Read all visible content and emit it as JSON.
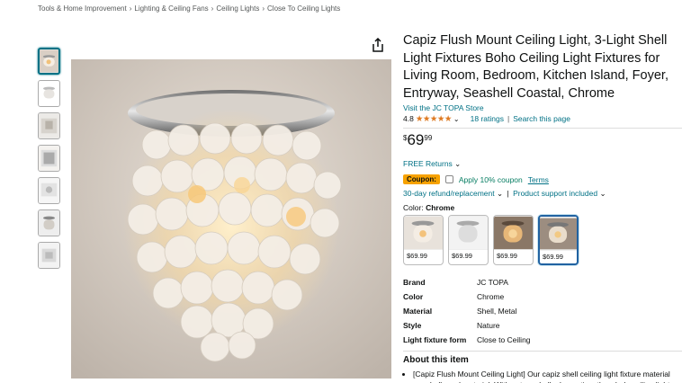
{
  "breadcrumb": [
    "Tools & Home Improvement",
    "Lighting & Ceiling Fans",
    "Ceiling Lights",
    "Close To Ceiling Lights"
  ],
  "breadcrumb_sep": "›",
  "product": {
    "title": "Capiz Flush Mount Ceiling Light, 3-Light Shell Light Fixtures Boho Ceiling Light Fixtures for Living Room, Bedroom, Kitchen Island, Foyer, Entryway, Seashell Coastal, Chrome",
    "store": "Visit the JC TOPA Store",
    "rating": "4.8",
    "stars": "★★★★★",
    "rating_value": 4.8,
    "ratings_count": "18 ratings",
    "search_page": "Search this page",
    "price_symbol": "$",
    "price_whole": "69",
    "price_fraction": "99",
    "free_returns": "FREE Returns",
    "coupon_badge": "Coupon:",
    "coupon_text": "Apply 10% coupon",
    "terms": "Terms",
    "refund": "30-day refund/replacement",
    "support": "Product support included",
    "color_label": "Color:",
    "color_value": "Chrome"
  },
  "swatches": [
    {
      "price": "$69.99",
      "selected": false
    },
    {
      "price": "$69.99",
      "selected": false
    },
    {
      "price": "$69.99",
      "selected": false
    },
    {
      "price": "$69.99",
      "selected": true
    }
  ],
  "specs": [
    {
      "key": "Brand",
      "value": "JC TOPA"
    },
    {
      "key": "Color",
      "value": "Chrome"
    },
    {
      "key": "Material",
      "value": "Shell, Metal"
    },
    {
      "key": "Style",
      "value": "Nature"
    },
    {
      "key": "Light fixture form",
      "value": "Close to Ceiling"
    }
  ],
  "about": {
    "title": "About this item",
    "items": [
      "[Capiz Flush Mount Ceiling Light] Our capiz shell ceiling light fixture material are shells and material. With nature shells decoration, the whole ceiling light"
    ]
  },
  "icons": {
    "share": "share-icon",
    "chevron": "chevron-down-icon"
  },
  "colors": {
    "link": "#007185",
    "star": "#de7921",
    "coupon": "#f7a200",
    "coupon_text": "#067d62",
    "selected_border": "#2162a1"
  }
}
